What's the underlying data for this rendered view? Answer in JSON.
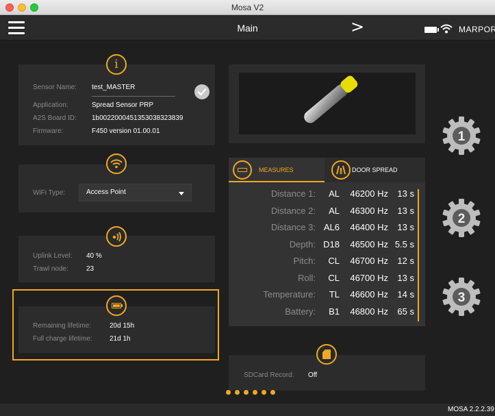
{
  "window": {
    "title": "Mosa V2"
  },
  "header": {
    "title": "Main",
    "next_symbol": ">",
    "brand": "MARPORT"
  },
  "sensor_panel": {
    "rows": [
      {
        "label": "Sensor Name:",
        "value": "test_MASTER"
      },
      {
        "label": "Application:",
        "value": "Spread Sensor PRP"
      },
      {
        "label": "A2S Board ID:",
        "value": "1b0022000451353038323839"
      },
      {
        "label": "Firmware:",
        "value": "F450 version 01.00.01"
      }
    ]
  },
  "wifi_panel": {
    "label": "WiFi Type:",
    "value": "Access Point"
  },
  "uplink_panel": {
    "rows": [
      {
        "label": "Uplink Level:",
        "value": "40 %"
      },
      {
        "label": "Trawl node:",
        "value": "23"
      }
    ]
  },
  "battery_panel": {
    "rows": [
      {
        "label": "Remaining lifetime:",
        "value": "20d 15h"
      },
      {
        "label": "Full charge lifetime:",
        "value": "21d 1h"
      }
    ]
  },
  "tabs": {
    "measures": "MEASURES",
    "door_spread": "DOOR SPREAD"
  },
  "measures": [
    {
      "name": "Distance 1:",
      "node": "AL",
      "freq": "46200 Hz",
      "time": "13 s"
    },
    {
      "name": "Distance 2:",
      "node": "AL",
      "freq": "46300 Hz",
      "time": "13 s"
    },
    {
      "name": "Distance 3:",
      "node": "AL6",
      "freq": "46400 Hz",
      "time": "13 s"
    },
    {
      "name": "Depth:",
      "node": "D18",
      "freq": "46500 Hz",
      "time": "5.5 s"
    },
    {
      "name": "Pitch:",
      "node": "CL",
      "freq": "46700 Hz",
      "time": "12 s"
    },
    {
      "name": "Roll:",
      "node": "CL",
      "freq": "46700 Hz",
      "time": "13 s"
    },
    {
      "name": "Temperature:",
      "node": "TL",
      "freq": "46600 Hz",
      "time": "14 s"
    },
    {
      "name": "Battery:",
      "node": "B1",
      "freq": "46800 Hz",
      "time": "65 s"
    }
  ],
  "sdcard": {
    "label": "SDCard Record:",
    "value": "Off"
  },
  "gear_buttons": [
    {
      "number": "1"
    },
    {
      "number": "2"
    },
    {
      "number": "3"
    }
  ],
  "pager": {
    "count": 6
  },
  "footer": {
    "version": "MOSA 2.2.2.39"
  },
  "colors": {
    "accent": "#f0a922",
    "panel": "#2c2c2c",
    "background": "#1f1f1f"
  },
  "icons": {
    "menu": "hamburger-icon",
    "info": "info-icon",
    "wifi": "wifi-icon",
    "uplink": "signal-icon",
    "battery": "battery-icon",
    "sdcard": "sdcard-icon",
    "measures": "measures-icon",
    "door_spread": "door-spread-icon",
    "settings": "gear-icon"
  }
}
